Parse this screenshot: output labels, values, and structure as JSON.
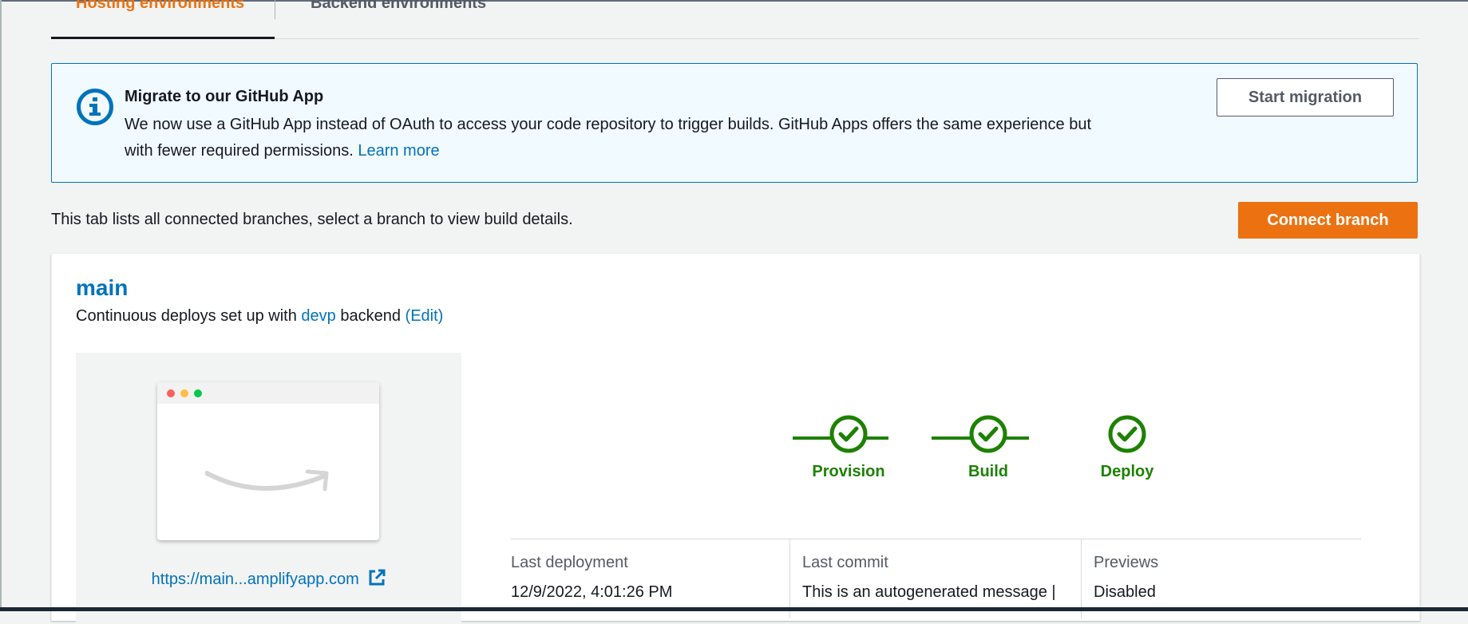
{
  "tabs": [
    {
      "label": "Hosting environments"
    },
    {
      "label": "Backend environments"
    }
  ],
  "banner": {
    "icon": "info-icon",
    "title": "Migrate to our GitHub App",
    "body_line1": "We now use a GitHub App instead of OAuth to access your code repository to trigger builds. GitHub Apps offers the same experience but",
    "body_line2": "with fewer required permissions.",
    "learn_more": "Learn more",
    "button": "Start migration"
  },
  "description": "This tab lists all connected branches, select a branch to view build details.",
  "connect_button": "Connect branch",
  "branch": {
    "name": "main",
    "sub_prefix": "Continuous deploys set up with",
    "backend_link": "devp",
    "sub_mid": "backend",
    "edit_link": "(Edit)",
    "url": "https://main...amplifyapp.com",
    "steps": [
      {
        "label": "Provision",
        "status": "complete"
      },
      {
        "label": "Build",
        "status": "complete"
      },
      {
        "label": "Deploy",
        "status": "complete"
      }
    ],
    "meta": [
      {
        "label": "Last deployment",
        "value": "12/9/2022, 4:01:26 PM"
      },
      {
        "label": "Last commit",
        "value": "This is an autogenerated message |"
      },
      {
        "label": "Previews",
        "value": "Disabled"
      }
    ]
  },
  "colors": {
    "accent": "#ec7211",
    "link": "#0073bb",
    "success": "#1d8102",
    "info_bg": "#f1faff"
  }
}
